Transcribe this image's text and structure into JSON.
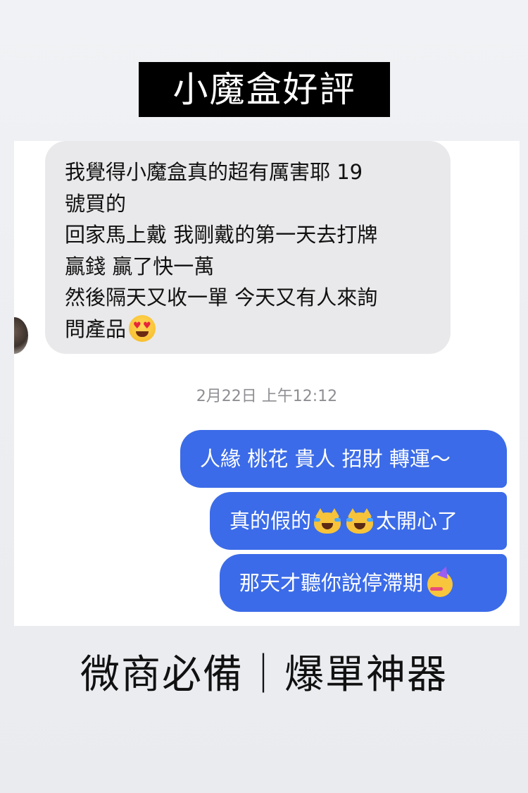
{
  "title": "小魔盒好評",
  "incoming_message": {
    "lines": [
      "我覺得小魔盒真的超有厲害耶 19",
      "號買的",
      "回家馬上戴 我剛戴的第一天去打牌",
      "贏錢 贏了快一萬",
      "然後隔天又收一單 今天又有人來詢",
      "問產品"
    ],
    "emoji": "smiling-face-with-heart-eyes"
  },
  "timestamp": "2月22日 上午12:12",
  "outgoing_messages": [
    {
      "text": "人緣 桃花 貴人 招財 轉運～"
    },
    {
      "text_before": "真的假的",
      "emoji": [
        "cat-with-tears-of-joy",
        "cat-with-tears-of-joy"
      ],
      "text_after": "太開心了"
    },
    {
      "text": "那天才聽你說停滯期",
      "emoji": "partying-face"
    }
  ],
  "tagline": "微商必備｜爆單神器",
  "colors": {
    "outgoing_bubble": "#3b6be8",
    "incoming_bubble": "#e9e9eb",
    "title_background": "#000000",
    "timestamp_text": "#8e8e93"
  }
}
